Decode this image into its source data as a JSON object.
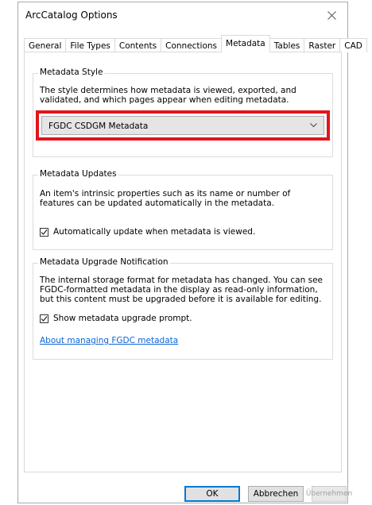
{
  "window": {
    "title": "ArcCatalog Options"
  },
  "tabs": [
    {
      "label": "General",
      "active": false
    },
    {
      "label": "File Types",
      "active": false
    },
    {
      "label": "Contents",
      "active": false
    },
    {
      "label": "Connections",
      "active": false
    },
    {
      "label": "Metadata",
      "active": true
    },
    {
      "label": "Tables",
      "active": false
    },
    {
      "label": "Raster",
      "active": false
    },
    {
      "label": "CAD",
      "active": false
    }
  ],
  "metadata_style": {
    "label": "Metadata Style",
    "description": "The style determines how metadata is viewed, exported, and validated, and which pages appear when editing metadata.",
    "selected": "FGDC CSDGM Metadata"
  },
  "metadata_updates": {
    "label": "Metadata Updates",
    "description": "An item's intrinsic properties such as its name or number of features can be updated automatically in the metadata.",
    "checkbox_label": "Automatically update when metadata is viewed.",
    "checked": true
  },
  "upgrade_notification": {
    "label": "Metadata Upgrade Notification",
    "description": "The internal storage format for metadata has changed. You can see FGDC-formatted metadata in the display as read-only information, but this content must be upgraded before it is available for editing.",
    "checkbox_label": "Show metadata upgrade prompt.",
    "checked": true,
    "link_text": "About managing FGDC metadata"
  },
  "buttons": {
    "ok": "OK",
    "cancel": "Abbrechen",
    "apply": "Übernehmen"
  },
  "colors": {
    "highlight": "#e3141c",
    "link": "#0b66d6"
  }
}
